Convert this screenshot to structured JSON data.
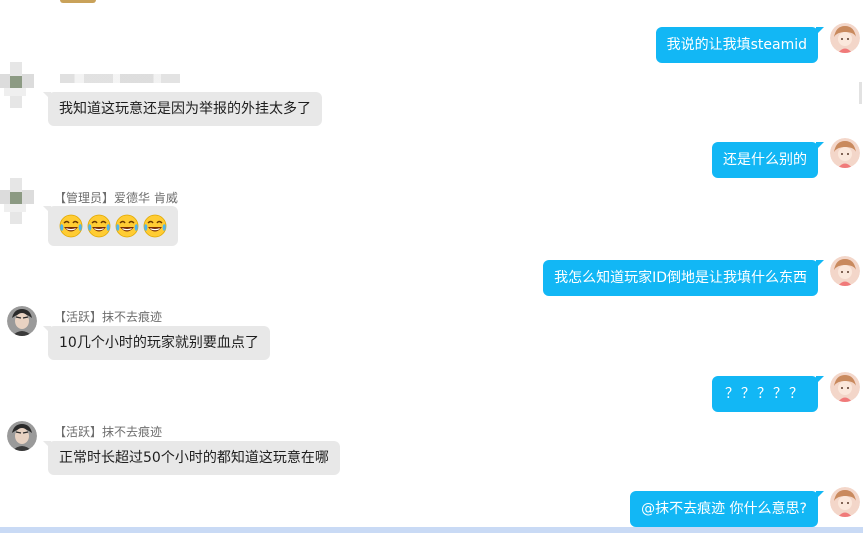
{
  "colors": {
    "outgoing_bubble": "#12b7f5",
    "incoming_bubble": "#e8e8e8",
    "name_text": "#6e6e6e",
    "bottom_bar": "#c9daf5"
  },
  "messages": [
    {
      "direction": "out",
      "text": "我说的让我填steamid",
      "avatar": "self-avatar-icon"
    },
    {
      "direction": "in",
      "sender": "",
      "text": "我知道这玩意还是因为举报的外挂太多了",
      "avatar": "blurred-avatar"
    },
    {
      "direction": "out",
      "text": "还是什么别的",
      "avatar": "self-avatar-icon"
    },
    {
      "direction": "in",
      "sender": "【管理员】爱德华 肯威",
      "emoji": [
        "laugh-cry-emoji",
        "laugh-cry-emoji",
        "laugh-cry-emoji",
        "laugh-cry-emoji"
      ],
      "avatar": "blurred-avatar"
    },
    {
      "direction": "out",
      "text": "我怎么知道玩家ID倒地是让我填什么东西",
      "avatar": "self-avatar-icon"
    },
    {
      "direction": "in",
      "sender": "【活跃】抹不去痕迹",
      "text": "10几个小时的玩家就别要血点了",
      "avatar": "user-avatar-icon"
    },
    {
      "direction": "out",
      "text": "？？？？？",
      "avatar": "self-avatar-icon"
    },
    {
      "direction": "in",
      "sender": "【活跃】抹不去痕迹",
      "text": "正常时长超过50个小时的都知道这玩意在哪",
      "avatar": "user-avatar-icon"
    },
    {
      "direction": "out",
      "text": "@抹不去痕迹 你什么意思?",
      "avatar": "self-avatar-icon"
    }
  ]
}
